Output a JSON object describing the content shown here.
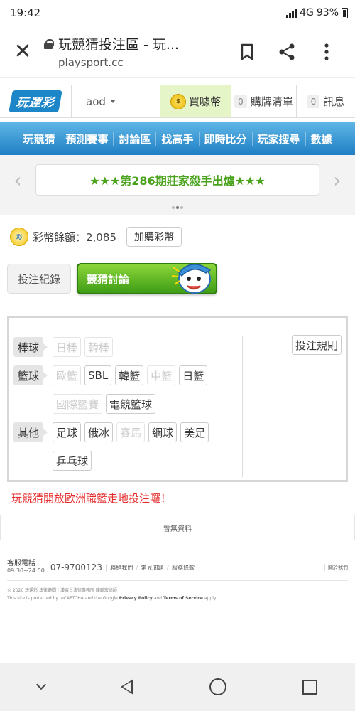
{
  "status_bar": {
    "time": "19:42",
    "network": "4G",
    "battery": "93%"
  },
  "browser": {
    "title": "玩競猜投注區 - 玩...",
    "domain": "playsport.cc"
  },
  "site_header": {
    "logo_text": "玩運彩",
    "user": "aod",
    "buy_coins_label": "買噱幣",
    "cart_count": "0",
    "cart_label": "購牌清單",
    "msg_count": "0",
    "msg_label": "訊息"
  },
  "nav": {
    "items": [
      "玩競猜",
      "預測賽事",
      "討論區",
      "找高手",
      "即時比分",
      "玩家搜尋",
      "數據"
    ]
  },
  "banner": {
    "text": "★★★第286期莊家殺手出爐★★★",
    "current_slide": 2,
    "total_slides": 3
  },
  "balance": {
    "label": "彩幣餘額：2,085",
    "buy_label": "加購彩幣"
  },
  "tabs": {
    "log_label": "投注紀錄",
    "discussion_label": "競猜討論"
  },
  "sports": {
    "rules_label": "投注規則",
    "baseball": {
      "label": "棒球",
      "items": [
        "日棒",
        "韓棒"
      ]
    },
    "basketball": {
      "label": "籃球",
      "row1": [
        "歐籃",
        "SBL",
        "韓籃",
        "中籃",
        "日籃"
      ],
      "row2": [
        "國際籃賽",
        "電競籃球"
      ]
    },
    "other": {
      "label": "其他",
      "row1": [
        "足球",
        "俄冰",
        "賽馬",
        "網球",
        "美足"
      ],
      "row2": [
        "乒乓球"
      ]
    }
  },
  "notice": "玩競猜開放歐洲職籃走地投注囉！",
  "empty_message": "暫無資料",
  "footer": {
    "hotline_label": "客服電話",
    "hotline_hours": "09:30~24:00",
    "phone": "07-9700123",
    "links": [
      "聯絡我們",
      "常見問題",
      "服務條款"
    ],
    "right_link": "關於我們",
    "copyright": "© 2020 玩運彩 法律顧問｜漢宸台法律事務所 陳鵬宏律師",
    "captcha_prefix": "This site is protected by reCAPTCHA and the Google",
    "privacy": "Privacy Policy",
    "and": "and",
    "terms": "Terms of Service",
    "apply": "apply."
  }
}
